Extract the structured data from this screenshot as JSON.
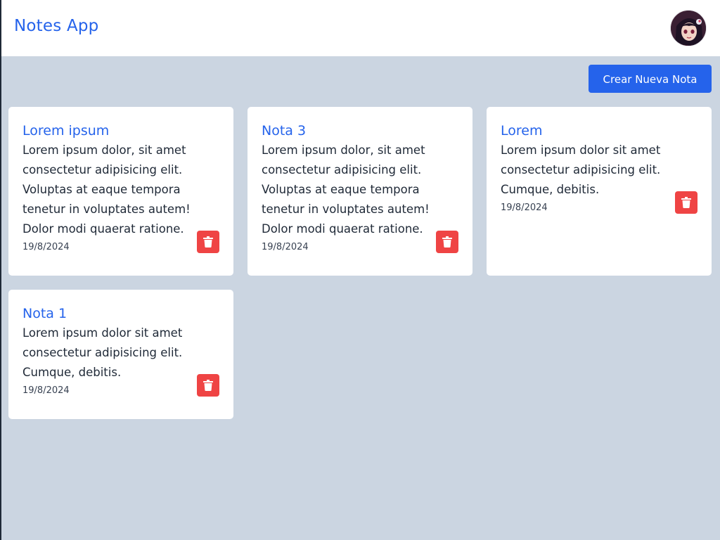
{
  "header": {
    "title": "Notes App",
    "avatar_alt": "avatar"
  },
  "toolbar": {
    "create_label": "Crear Nueva Nota"
  },
  "colors": {
    "primary": "#2563eb",
    "danger": "#ef4444",
    "background": "#cbd5e1"
  },
  "notes": [
    {
      "title": "Lorem ipsum",
      "body": "Lorem ipsum dolor, sit amet consectetur adipisicing elit. Voluptas at eaque tempora tenetur in voluptates autem! Dolor modi quaerat ratione.",
      "date": "19/8/2024",
      "delete_icon": "trash-icon"
    },
    {
      "title": "Nota 3",
      "body": "Lorem ipsum dolor, sit amet consectetur adipisicing elit. Voluptas at eaque tempora tenetur in voluptates autem! Dolor modi quaerat ratione.",
      "date": "19/8/2024",
      "delete_icon": "trash-icon"
    },
    {
      "title": "Lorem",
      "body": "Lorem ipsum dolor sit amet consectetur adipisicing elit. Cumque, debitis.",
      "date": "19/8/2024",
      "delete_icon": "trash-icon"
    },
    {
      "title": "Nota 1",
      "body": "Lorem ipsum dolor sit amet consectetur adipisicing elit. Cumque, debitis.",
      "date": "19/8/2024",
      "delete_icon": "trash-icon"
    }
  ]
}
